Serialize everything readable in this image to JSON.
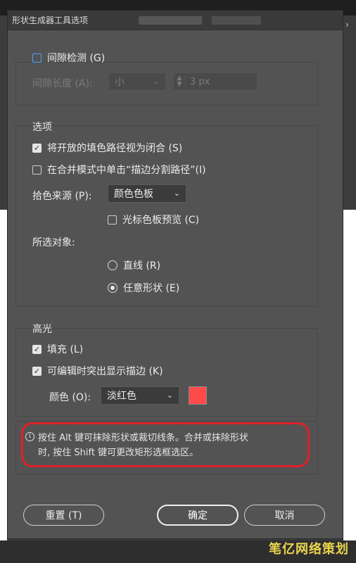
{
  "dialog": {
    "title": "形状生成器工具选项"
  },
  "gap_detection": {
    "label": "间隙检测 (G)",
    "checked": false,
    "length_label": "间隙长度 (A):",
    "length_select": "小",
    "length_value": "3 px"
  },
  "options": {
    "section_label": "选项",
    "treat_open_paths": {
      "label": "将开放的填色路径视为闭合 (S)",
      "checked": true
    },
    "click_stroke_split": {
      "label": "在合并模式中单击“描边分割路径”(I)",
      "checked": false
    },
    "color_source_label": "拾色来源 (P):",
    "color_source_value": "颜色色板",
    "cursor_preview": {
      "label": "光标色板预览 (C)",
      "checked": false
    },
    "selection_label": "所选对象:",
    "radio_straight": {
      "label": "直线 (R)",
      "selected": false
    },
    "radio_freeform": {
      "label": "任意形状 (E)",
      "selected": true
    }
  },
  "highlight": {
    "section_label": "高光",
    "fill": {
      "label": "填充 (L)",
      "checked": true
    },
    "editable_stroke": {
      "label": "可编辑时突出显示描边 (K)",
      "checked": true
    },
    "color_label": "颜色 (O):",
    "color_value": "淡红色",
    "swatch_color": "#ff4a4a"
  },
  "info": {
    "line1": "按住 Alt 键可抹除形状或裁切线条。合并或抹除形状",
    "line2": "时, 按住 Shift 键可更改矩形选框选区。"
  },
  "buttons": {
    "reset": "重置 (T)",
    "ok": "确定",
    "cancel": "取消"
  },
  "watermark": "笔亿网络策划",
  "colors": {
    "accent_red": "#e0202a",
    "dialog_bg": "#535353"
  }
}
